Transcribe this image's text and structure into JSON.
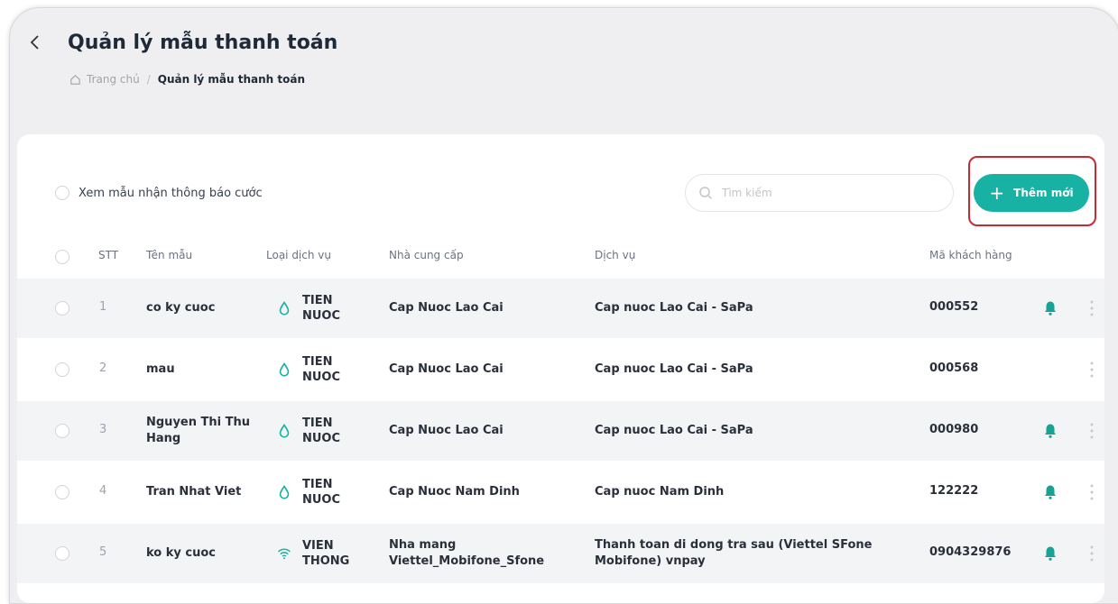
{
  "header": {
    "title": "Quản lý mẫu thanh toán",
    "breadcrumb": {
      "home": "Trang chủ",
      "separator": "/",
      "current": "Quản lý mẫu thanh toán"
    }
  },
  "toolbar": {
    "view_toggle_label": "Xem mẫu nhận thông báo cước",
    "search_placeholder": "Tìm kiếm",
    "add_label": "Thêm mới"
  },
  "table": {
    "columns": {
      "stt": "STT",
      "name": "Tên mẫu",
      "type": "Loại dịch vụ",
      "provider": "Nhà cung cấp",
      "service": "Dịch vụ",
      "code": "Mã khách hàng"
    },
    "rows": [
      {
        "stt": "1",
        "name": "co ky cuoc",
        "type_icon": "water-drop-icon",
        "type": "TIEN NUOC",
        "provider": "Cap Nuoc Lao Cai",
        "service": "Cap nuoc Lao Cai - SaPa",
        "code": "000552",
        "bell": true
      },
      {
        "stt": "2",
        "name": "mau",
        "type_icon": "water-drop-icon",
        "type": "TIEN NUOC",
        "provider": "Cap Nuoc Lao Cai",
        "service": "Cap nuoc Lao Cai - SaPa",
        "code": "000568",
        "bell": false
      },
      {
        "stt": "3",
        "name": "Nguyen Thi Thu Hang",
        "type_icon": "water-drop-icon",
        "type": "TIEN NUOC",
        "provider": "Cap Nuoc Lao Cai",
        "service": "Cap nuoc Lao Cai - SaPa",
        "code": "000980",
        "bell": true
      },
      {
        "stt": "4",
        "name": "Tran Nhat Viet",
        "type_icon": "water-drop-icon",
        "type": "TIEN NUOC",
        "provider": "Cap Nuoc Nam Dinh",
        "service": "Cap nuoc Nam Dinh",
        "code": "122222",
        "bell": true
      },
      {
        "stt": "5",
        "name": "ko ky cuoc",
        "type_icon": "wifi-icon",
        "type": "VIEN THONG",
        "provider": "Nha mang Viettel_Mobifone_Sfone",
        "service": "Thanh toan di dong tra sau (Viettel SFone Mobifone) vnpay",
        "code": "0904329876",
        "bell": true
      }
    ]
  },
  "colors": {
    "accent": "#17b2a3",
    "highlight": "#c42b32",
    "page_bg": "#efeff1",
    "row_alt": "#f3f4f6"
  }
}
